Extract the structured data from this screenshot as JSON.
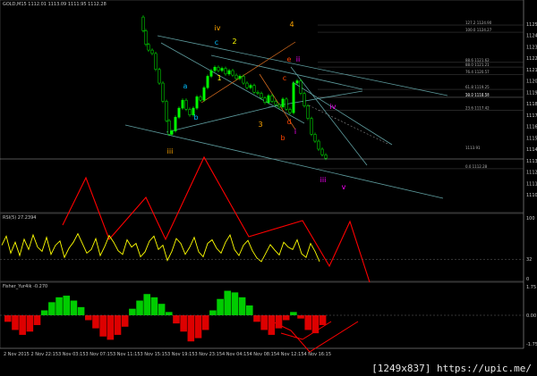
{
  "header": {
    "main_title": "GOLD,M15  1112.01 1113.09 1111.95 1112.28",
    "rsi_title": "RSI(5) 27.2394",
    "fisher_title": "Fisher_Yur4ik -0.270"
  },
  "watermark": "[1249x837] https://upic.me/",
  "colors": {
    "bull_candle": "#00ff00",
    "wave_black_counts": "#ffa500",
    "wave_purple_counts": "#ff00ff",
    "wave_red_counts": "#ff4500",
    "wave_blue_counts": "#00bfff",
    "wave_yellow_counts": "#ffff00",
    "channel_lines": "#5f9ea0",
    "zigzag_red": "#ff0000",
    "rsi_line": "#ffff00",
    "fisher_positive": "#00cc00",
    "fisher_negative": "#dd0000",
    "fib_levels": "#b0b0b0"
  },
  "chart_data": [
    {
      "type": "line",
      "name": "price",
      "symbol": "GOLD",
      "timeframe": "M15",
      "x_ticks": [
        "2 Nov 2015",
        "2 Nov 22:15",
        "3 Nov 03:15",
        "3 Nov 07:15",
        "3 Nov 11:15",
        "3 Nov 15:15",
        "3 Nov 19:15",
        "3 Nov 23:15",
        "4 Nov 04:15",
        "4 Nov 08:15",
        "4 Nov 12:15",
        "4 Nov 16:15"
      ],
      "y_ticks": [
        "1125",
        "1124",
        "1123",
        "1122",
        "1121",
        "1120",
        "1119",
        "1118",
        "1117",
        "1116",
        "1115",
        "1114",
        "1113",
        "1112",
        "1111",
        "1110"
      ],
      "ylim": [
        1110,
        1126
      ],
      "fib_labels": [
        "127.2  1124.90",
        "100.0  1124.27",
        "88.6  1121.62",
        "88.0  1121.21",
        "76.4  1120.57",
        "61.8  1119.25",
        "50.0  1118.58",
        "38.2  1118.54",
        "23.6  1117.42",
        "0.0  1112.28"
      ],
      "price_labels": [
        "1113.91"
      ],
      "wave_labels": {
        "orange": [
          "iv",
          "iii",
          "4",
          "3"
        ],
        "blue": [
          "c",
          "a",
          "b"
        ],
        "yellow": [
          "2",
          "1"
        ],
        "red": [
          "e",
          "c",
          "d",
          "b"
        ],
        "purple": [
          "ii",
          "iv",
          "i",
          "iii",
          "v"
        ]
      }
    },
    {
      "type": "line",
      "name": "RSI(5)",
      "ylim": [
        0,
        100
      ],
      "y_ticks": [
        "100",
        "32",
        "0"
      ],
      "value": 27.2394
    },
    {
      "type": "bar",
      "name": "Fisher_Yur4ik",
      "ylim": [
        -1.75,
        1.75
      ],
      "y_ticks": [
        "1.75",
        "0.00",
        "-1.75"
      ],
      "value": -0.27
    }
  ]
}
